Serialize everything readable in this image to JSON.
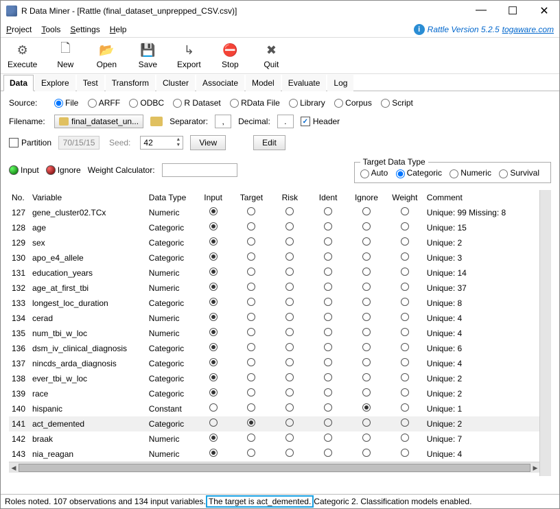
{
  "title": "R Data Miner - [Rattle (final_dataset_unprepped_CSV.csv)]",
  "menus": [
    "Project",
    "Tools",
    "Settings",
    "Help"
  ],
  "version": {
    "text": "Rattle Version 5.2.5",
    "link": "togaware.com"
  },
  "toolbar": [
    {
      "label": "Execute",
      "glyph": "⚙"
    },
    {
      "label": "New",
      "glyph": "🗋"
    },
    {
      "label": "Open",
      "glyph": "📂"
    },
    {
      "label": "Save",
      "glyph": "💾"
    },
    {
      "label": "Export",
      "glyph": "↳"
    },
    {
      "label": "Stop",
      "glyph": "⛔"
    },
    {
      "label": "Quit",
      "glyph": "✖"
    }
  ],
  "tabs": [
    "Data",
    "Explore",
    "Test",
    "Transform",
    "Cluster",
    "Associate",
    "Model",
    "Evaluate",
    "Log"
  ],
  "active_tab": "Data",
  "source": {
    "label": "Source:",
    "options": [
      "File",
      "ARFF",
      "ODBC",
      "R Dataset",
      "RData File",
      "Library",
      "Corpus",
      "Script"
    ],
    "selected": "File"
  },
  "filename_row": {
    "label": "Filename:",
    "file": "final_dataset_un...",
    "sep_label": "Separator:",
    "sep": ",",
    "dec_label": "Decimal:",
    "dec": ".",
    "header_label": "Header",
    "header_checked": true
  },
  "partition_row": {
    "label": "Partition",
    "checked": false,
    "split": "70/15/15",
    "seed_label": "Seed:",
    "seed": "42",
    "view_btn": "View",
    "edit_btn": "Edit"
  },
  "role_buttons": {
    "input": "Input",
    "ignore": "Ignore",
    "wcalc": "Weight Calculator:"
  },
  "tdt": {
    "legend": "Target Data Type",
    "options": [
      "Auto",
      "Categoric",
      "Numeric",
      "Survival"
    ],
    "selected": "Categoric"
  },
  "columns": [
    "No.",
    "Variable",
    "Data Type",
    "Input",
    "Target",
    "Risk",
    "Ident",
    "Ignore",
    "Weight",
    "Comment"
  ],
  "rows": [
    {
      "no": "127",
      "var": "gene_cluster02.TCx",
      "type": "Numeric",
      "role": "Input",
      "comment": "Unique: 99 Missing: 8"
    },
    {
      "no": "128",
      "var": "age",
      "type": "Categoric",
      "role": "Input",
      "comment": "Unique: 15"
    },
    {
      "no": "129",
      "var": "sex",
      "type": "Categoric",
      "role": "Input",
      "comment": "Unique: 2"
    },
    {
      "no": "130",
      "var": "apo_e4_allele",
      "type": "Categoric",
      "role": "Input",
      "comment": "Unique: 3"
    },
    {
      "no": "131",
      "var": "education_years",
      "type": "Numeric",
      "role": "Input",
      "comment": "Unique: 14"
    },
    {
      "no": "132",
      "var": "age_at_first_tbi",
      "type": "Numeric",
      "role": "Input",
      "comment": "Unique: 37"
    },
    {
      "no": "133",
      "var": "longest_loc_duration",
      "type": "Categoric",
      "role": "Input",
      "comment": "Unique: 8"
    },
    {
      "no": "134",
      "var": "cerad",
      "type": "Numeric",
      "role": "Input",
      "comment": "Unique: 4"
    },
    {
      "no": "135",
      "var": "num_tbi_w_loc",
      "type": "Numeric",
      "role": "Input",
      "comment": "Unique: 4"
    },
    {
      "no": "136",
      "var": "dsm_iv_clinical_diagnosis",
      "type": "Categoric",
      "role": "Input",
      "comment": "Unique: 6"
    },
    {
      "no": "137",
      "var": "nincds_arda_diagnosis",
      "type": "Categoric",
      "role": "Input",
      "comment": "Unique: 4"
    },
    {
      "no": "138",
      "var": "ever_tbi_w_loc",
      "type": "Categoric",
      "role": "Input",
      "comment": "Unique: 2"
    },
    {
      "no": "139",
      "var": "race",
      "type": "Categoric",
      "role": "Input",
      "comment": "Unique: 2"
    },
    {
      "no": "140",
      "var": "hispanic",
      "type": "Constant",
      "role": "Ignore",
      "comment": "Unique: 1"
    },
    {
      "no": "141",
      "var": "act_demented",
      "type": "Categoric",
      "role": "Target",
      "comment": "Unique: 2",
      "hl": true
    },
    {
      "no": "142",
      "var": "braak",
      "type": "Numeric",
      "role": "Input",
      "comment": "Unique: 7"
    },
    {
      "no": "143",
      "var": "nia_reagan",
      "type": "Numeric",
      "role": "Input",
      "comment": "Unique: 4"
    }
  ],
  "status": {
    "pre": "Roles noted. 107 observations and 134 input variables.",
    "highlight": "The target is act_demented.",
    "post": "Categoric 2. Classification models enabled."
  }
}
